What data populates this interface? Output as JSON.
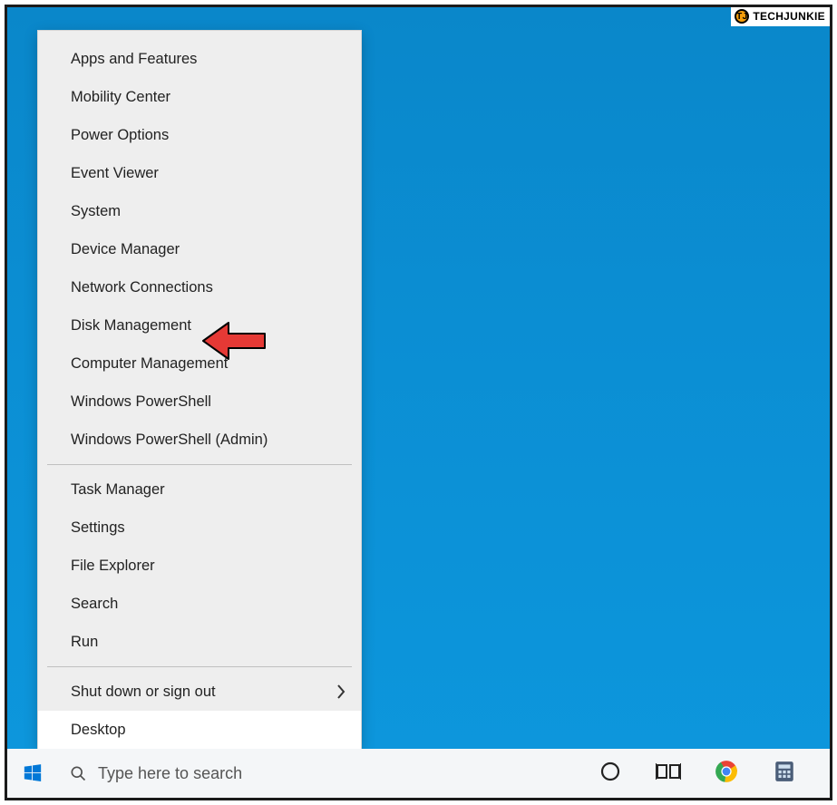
{
  "watermark": {
    "text": "TECHJUNKIE",
    "icon_text": "TJ"
  },
  "menu": {
    "groups": [
      [
        {
          "id": "apps-and-features",
          "label": "Apps and Features"
        },
        {
          "id": "mobility-center",
          "label": "Mobility Center"
        },
        {
          "id": "power-options",
          "label": "Power Options"
        },
        {
          "id": "event-viewer",
          "label": "Event Viewer"
        },
        {
          "id": "system",
          "label": "System"
        },
        {
          "id": "device-manager",
          "label": "Device Manager"
        },
        {
          "id": "network-connections",
          "label": "Network Connections"
        },
        {
          "id": "disk-management",
          "label": "Disk Management",
          "annotated": true
        },
        {
          "id": "computer-management",
          "label": "Computer Management"
        },
        {
          "id": "windows-powershell",
          "label": "Windows PowerShell"
        },
        {
          "id": "windows-powershell-admin",
          "label": "Windows PowerShell (Admin)"
        }
      ],
      [
        {
          "id": "task-manager",
          "label": "Task Manager"
        },
        {
          "id": "settings",
          "label": "Settings"
        },
        {
          "id": "file-explorer",
          "label": "File Explorer"
        },
        {
          "id": "search",
          "label": "Search"
        },
        {
          "id": "run",
          "label": "Run"
        }
      ],
      [
        {
          "id": "shut-down-or-sign-out",
          "label": "Shut down or sign out",
          "submenu": true
        },
        {
          "id": "desktop",
          "label": "Desktop",
          "hover": true
        }
      ]
    ]
  },
  "taskbar": {
    "search_placeholder": "Type here to search",
    "icons": [
      {
        "id": "cortana",
        "name": "cortana-icon"
      },
      {
        "id": "task-view",
        "name": "task-view-icon"
      },
      {
        "id": "chrome",
        "name": "chrome-icon"
      },
      {
        "id": "calculator",
        "name": "calculator-icon"
      }
    ]
  },
  "annotation": {
    "target": "disk-management",
    "color": "#e53935"
  }
}
